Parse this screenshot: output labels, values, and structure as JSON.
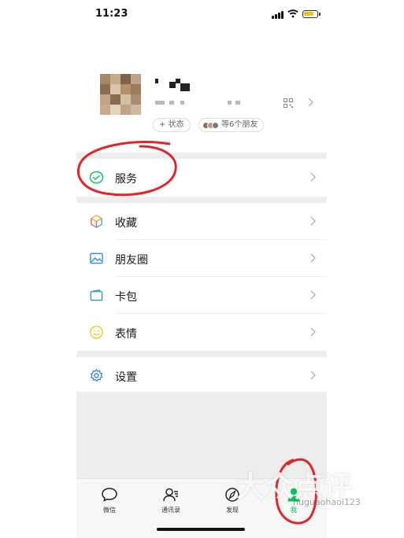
{
  "status_bar": {
    "time": "11:23"
  },
  "profile": {
    "status_button": "+ 状态",
    "friends_text": "等6个朋友"
  },
  "menu": {
    "services": "服务",
    "favorites": "收藏",
    "moments": "朋友圈",
    "cards": "卡包",
    "stickers": "表情",
    "settings": "设置"
  },
  "tabbar": {
    "chats": "微信",
    "contacts": "通讯录",
    "discover": "发现",
    "me": "我"
  },
  "watermark": {
    "brand": "大众点评",
    "user": "huguaohaoi123"
  },
  "colors": {
    "wechat_green": "#07c160",
    "annotation_red": "#e0262b",
    "background_gray": "#ededed"
  },
  "icons": {
    "services": "wechat-pay-icon",
    "favorites": "cube-icon",
    "moments": "picture-icon",
    "cards": "wallet-icon",
    "stickers": "smiley-icon",
    "settings": "gear-icon"
  }
}
